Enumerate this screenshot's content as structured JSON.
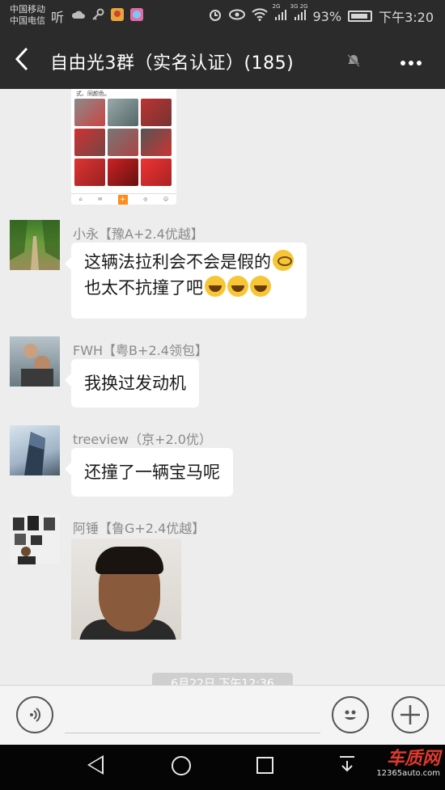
{
  "status_bar": {
    "carrier_1": "中国移动",
    "carrier_2": "中国电信",
    "ting": "听",
    "network_1": "2G",
    "network_2": "3G 2G",
    "battery_percent": "93%",
    "time": "下午3:20"
  },
  "header": {
    "back_icon": "back-arrow",
    "title": "自由光3群（实名认证）(185)",
    "mute_icon": "muted-bell",
    "more_icon": "ellipsis"
  },
  "shared_image": {
    "caption": "式、同颜色。"
  },
  "messages": [
    {
      "sender": "小永【豫A+2.4优越】",
      "text_line1": "这辆法拉利会不会是假的",
      "text_line2": "也太不抗撞了吧",
      "emojis": [
        "flushed-face",
        "crying-laughing-face",
        "crying-laughing-face",
        "crying-laughing-face"
      ]
    },
    {
      "sender": "FWH【粤B+2.4领包】",
      "text": "我换过发动机"
    },
    {
      "sender": "treeview（京+2.0优）",
      "text": "还撞了一辆宝马呢"
    },
    {
      "sender": "阿锤【鲁G+2.4优越】",
      "type": "photo"
    }
  ],
  "time_badge": "6月22日 下午12:36",
  "input_bar": {
    "voice_icon": "voice-input",
    "emoji_icon": "emoji-smile",
    "plus_icon": "plus"
  },
  "nav_bar": {
    "watermark_logo": "车质网",
    "watermark_url": "12365auto.com"
  },
  "colors": {
    "header_bg": "#2b2b2b",
    "chat_bg": "#ededed",
    "bubble_bg": "#ffffff",
    "nav_bg": "#050505",
    "accent_red": "#e03a2e"
  }
}
